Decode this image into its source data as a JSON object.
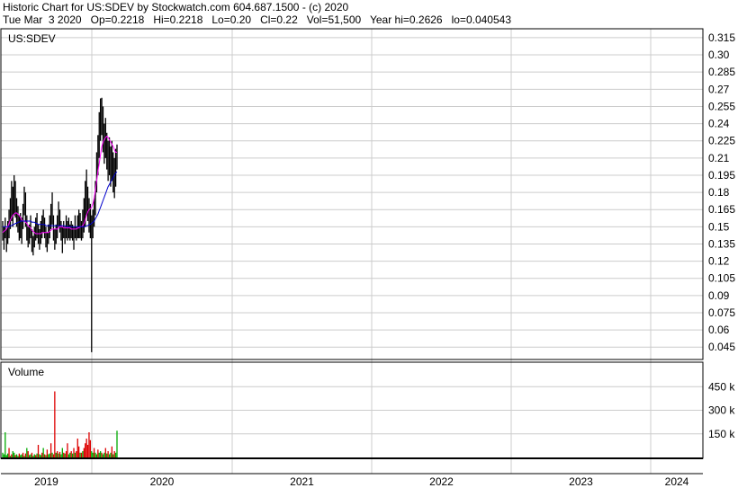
{
  "header": {
    "title": "Historic Chart for US:SDEV by Stockwatch.com 604.687.1500 - (c) 2020",
    "quote": "Tue Mar  3 2020   Op=0.2218   Hi=0.2218   Lo=0.20   Cl=0.22   Vol=51,500   Year hi=0.2626   lo=0.040543"
  },
  "colors": {
    "price_bar": "#000000",
    "ma_short": "#ff00ff",
    "ma_long": "#0000cc",
    "volume_up": "#00aa00",
    "volume_down": "#dd0000",
    "grid": "#cccccc"
  },
  "chart_data": [
    {
      "type": "bar",
      "panel": "price",
      "symbol_label": "US:SDEV",
      "y_ticks": [
        "0.315",
        "0.30",
        "0.285",
        "0.27",
        "0.255",
        "0.24",
        "0.225",
        "0.21",
        "0.195",
        "0.18",
        "0.165",
        "0.15",
        "0.135",
        "0.12",
        "0.105",
        "0.09",
        "0.075",
        "0.06",
        "0.045"
      ],
      "ylim": [
        0.035,
        0.322
      ],
      "x_ticks": [
        "2019",
        "2020",
        "2021",
        "2022",
        "2023",
        "2024"
      ],
      "series": [
        {
          "values": [
            0.148,
            0.142,
            0.15,
            0.138,
            0.146,
            0.152,
            0.16,
            0.172,
            0.168,
            0.18,
            0.175,
            0.165,
            0.158,
            0.15,
            0.154,
            0.148,
            0.16,
            0.175,
            0.168,
            0.15,
            0.142,
            0.145,
            0.152,
            0.138,
            0.135,
            0.142,
            0.148,
            0.15,
            0.145,
            0.14,
            0.146,
            0.15,
            0.155,
            0.15,
            0.142,
            0.138,
            0.145,
            0.15,
            0.16,
            0.168,
            0.15,
            0.14,
            0.145,
            0.152,
            0.165,
            0.158,
            0.148,
            0.147,
            0.15,
            0.145,
            0.152,
            0.148,
            0.15,
            0.147,
            0.15,
            0.148,
            0.147,
            0.152,
            0.145,
            0.15,
            0.152,
            0.15,
            0.148,
            0.155,
            0.16,
            0.17,
            0.185,
            0.175,
            0.165,
            0.16,
            0.15,
            0.155,
            0.165,
            0.178,
            0.2,
            0.215,
            0.23,
            0.245,
            0.252,
            0.238,
            0.225,
            0.23,
            0.22,
            0.21,
            0.215,
            0.205,
            0.21,
            0.2,
            0.195,
            0.205,
            0.22
          ]
        },
        {
          "values": [
            0.145,
            0.146,
            0.147,
            0.148,
            0.15,
            0.153,
            0.156,
            0.158,
            0.16,
            0.161,
            0.162,
            0.162,
            0.161,
            0.16,
            0.158,
            0.156,
            0.155,
            0.155,
            0.154,
            0.153,
            0.151,
            0.15,
            0.149,
            0.147,
            0.146,
            0.145,
            0.144,
            0.144,
            0.144,
            0.144,
            0.144,
            0.145,
            0.145,
            0.145,
            0.145,
            0.145,
            0.145,
            0.146,
            0.147,
            0.148,
            0.148,
            0.148,
            0.148,
            0.148,
            0.149,
            0.15,
            0.15,
            0.15,
            0.149,
            0.149,
            0.149,
            0.149,
            0.149,
            0.149,
            0.148,
            0.148,
            0.148,
            0.148,
            0.148,
            0.149,
            0.149,
            0.15,
            0.15,
            0.151,
            0.153,
            0.156,
            0.16,
            0.163,
            0.165,
            0.166,
            0.167,
            0.17,
            0.175,
            0.182,
            0.19,
            0.198,
            0.205,
            0.213,
            0.22,
            0.224,
            0.226,
            0.228,
            0.229,
            0.228,
            0.226,
            0.224,
            0.222,
            0.22,
            0.217,
            0.215,
            0.215
          ]
        },
        {
          "values": [
            0.15,
            0.15,
            0.15,
            0.15,
            0.15,
            0.15,
            0.151,
            0.151,
            0.152,
            0.152,
            0.153,
            0.153,
            0.154,
            0.154,
            0.155,
            0.155,
            0.155,
            0.155,
            0.155,
            0.155,
            0.155,
            0.155,
            0.155,
            0.154,
            0.154,
            0.154,
            0.153,
            0.153,
            0.152,
            0.152,
            0.152,
            0.152,
            0.152,
            0.152,
            0.151,
            0.151,
            0.151,
            0.151,
            0.151,
            0.151,
            0.151,
            0.151,
            0.151,
            0.151,
            0.151,
            0.151,
            0.151,
            0.151,
            0.151,
            0.151,
            0.15,
            0.15,
            0.15,
            0.15,
            0.15,
            0.15,
            0.15,
            0.15,
            0.15,
            0.15,
            0.15,
            0.15,
            0.15,
            0.15,
            0.15,
            0.15,
            0.151,
            0.151,
            0.152,
            0.152,
            0.153,
            0.154,
            0.155,
            0.157,
            0.159,
            0.161,
            0.164,
            0.167,
            0.17,
            0.173,
            0.176,
            0.179,
            0.182,
            0.185,
            0.187,
            0.189,
            0.191,
            0.193,
            0.195,
            0.197,
            0.198
          ]
        }
      ],
      "ranges": {
        "high": [
          0.155,
          0.15,
          0.158,
          0.148,
          0.155,
          0.165,
          0.175,
          0.19,
          0.185,
          0.195,
          0.19,
          0.175,
          0.168,
          0.16,
          0.162,
          0.158,
          0.17,
          0.185,
          0.18,
          0.16,
          0.15,
          0.152,
          0.16,
          0.148,
          0.142,
          0.15,
          0.158,
          0.162,
          0.152,
          0.148,
          0.155,
          0.16,
          0.165,
          0.158,
          0.15,
          0.145,
          0.152,
          0.16,
          0.17,
          0.18,
          0.16,
          0.148,
          0.152,
          0.16,
          0.172,
          0.165,
          0.155,
          0.15,
          0.155,
          0.15,
          0.16,
          0.155,
          0.158,
          0.152,
          0.155,
          0.152,
          0.15,
          0.16,
          0.15,
          0.16,
          0.165,
          0.162,
          0.155,
          0.165,
          0.175,
          0.19,
          0.2,
          0.185,
          0.175,
          0.17,
          0.16,
          0.165,
          0.175,
          0.19,
          0.215,
          0.23,
          0.25,
          0.262,
          0.2626,
          0.255,
          0.24,
          0.245,
          0.232,
          0.225,
          0.228,
          0.22,
          0.225,
          0.215,
          0.21,
          0.218,
          0.2218
        ],
        "low": [
          0.138,
          0.13,
          0.14,
          0.128,
          0.135,
          0.14,
          0.148,
          0.155,
          0.15,
          0.16,
          0.158,
          0.15,
          0.145,
          0.138,
          0.14,
          0.135,
          0.148,
          0.16,
          0.15,
          0.138,
          0.132,
          0.135,
          0.14,
          0.128,
          0.125,
          0.132,
          0.138,
          0.14,
          0.135,
          0.13,
          0.135,
          0.14,
          0.145,
          0.14,
          0.132,
          0.128,
          0.135,
          0.14,
          0.148,
          0.152,
          0.138,
          0.13,
          0.135,
          0.14,
          0.15,
          0.145,
          0.138,
          0.127,
          0.14,
          0.135,
          0.14,
          0.138,
          0.14,
          0.138,
          0.14,
          0.138,
          0.13,
          0.14,
          0.138,
          0.14,
          0.14,
          0.14,
          0.138,
          0.14,
          0.145,
          0.15,
          0.16,
          0.155,
          0.145,
          0.14,
          0.040543,
          0.14,
          0.15,
          0.16,
          0.18,
          0.195,
          0.21,
          0.225,
          0.23,
          0.215,
          0.205,
          0.21,
          0.2,
          0.19,
          0.195,
          0.185,
          0.19,
          0.18,
          0.175,
          0.185,
          0.2
        ]
      }
    },
    {
      "type": "bar",
      "panel": "volume",
      "title": "Volume",
      "y_ticks": [
        "450 k",
        "300 k",
        "150 k"
      ],
      "ylim": [
        0,
        600
      ],
      "values": [
        30,
        20,
        160,
        15,
        25,
        60,
        10,
        20,
        40,
        30,
        15,
        20,
        10,
        25,
        15,
        20,
        30,
        10,
        25,
        60,
        40,
        15,
        20,
        30,
        10,
        20,
        15,
        25,
        80,
        20,
        15,
        30,
        60,
        20,
        15,
        50,
        20,
        25,
        90,
        30,
        20,
        420,
        30,
        40,
        25,
        35,
        20,
        60,
        30,
        25,
        40,
        90,
        20,
        30,
        40,
        25,
        60,
        30,
        40,
        120,
        70,
        30,
        30,
        40,
        60,
        90,
        120,
        80,
        160,
        110,
        40,
        30,
        60,
        30,
        20,
        50,
        30,
        40,
        30,
        20,
        30,
        60,
        25,
        40,
        20,
        30,
        70,
        20,
        40,
        30,
        170
      ],
      "up": [
        1,
        1,
        1,
        1,
        1,
        0,
        1,
        0,
        1,
        1,
        0,
        1,
        1,
        0,
        1,
        1,
        0,
        1,
        0,
        1,
        0,
        1,
        1,
        0,
        1,
        1,
        0,
        1,
        0,
        1,
        1,
        0,
        1,
        0,
        1,
        0,
        1,
        1,
        0,
        1,
        0,
        0,
        1,
        0,
        1,
        0,
        1,
        1,
        0,
        1,
        0,
        0,
        1,
        1,
        0,
        1,
        0,
        1,
        0,
        0,
        0,
        1,
        0,
        1,
        0,
        0,
        0,
        0,
        0,
        0,
        1,
        1,
        0,
        1,
        1,
        0,
        1,
        1,
        0,
        1,
        1,
        0,
        1,
        0,
        1,
        1,
        0,
        1,
        0,
        1,
        1
      ]
    }
  ]
}
